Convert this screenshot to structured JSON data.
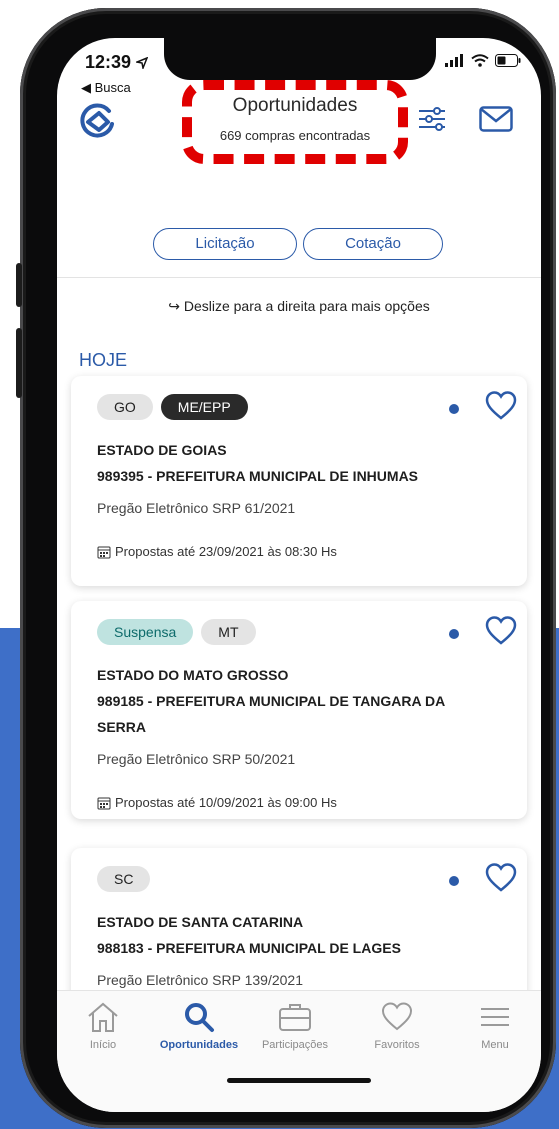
{
  "status_bar": {
    "time": "12:39",
    "back_label": "◀ Busca"
  },
  "header": {
    "title": "Oportunidades",
    "subtitle": "669 compras encontradas",
    "segments": [
      "Licitação",
      "Cotação"
    ]
  },
  "hint": "↪ Deslize para a direita para mais opções",
  "section_label": "HOJE",
  "cards": [
    {
      "tags": [
        "GO",
        "ME/EPP"
      ],
      "state": "ESTADO DE GOIAS",
      "org": "989395 - PREFEITURA MUNICIPAL DE INHUMAS",
      "org_line2": "",
      "modality": "Pregão Eletrônico SRP 61/2021",
      "deadline": "Propostas até 23/09/2021 às 08:30 Hs"
    },
    {
      "tags": [
        "Suspensa",
        "MT"
      ],
      "state": "ESTADO DO MATO GROSSO",
      "org": "989185 - PREFEITURA MUNICIPAL DE TANGARA DA",
      "org_line2": "SERRA",
      "modality": "Pregão Eletrônico SRP 50/2021",
      "deadline": "Propostas até 10/09/2021 às 09:00 Hs"
    },
    {
      "tags": [
        "SC"
      ],
      "state": "ESTADO DE SANTA CATARINA",
      "org": "988183 - PREFEITURA MUNICIPAL DE LAGES",
      "org_line2": "",
      "modality": "Pregão Eletrônico SRP 139/2021",
      "deadline": ""
    }
  ],
  "tabbar": [
    {
      "label": "Início",
      "icon": "home-icon",
      "active": false
    },
    {
      "label": "Oportunidades",
      "icon": "search-icon",
      "active": true
    },
    {
      "label": "Participações",
      "icon": "briefcase-icon",
      "active": false
    },
    {
      "label": "Favoritos",
      "icon": "heart-icon",
      "active": false
    },
    {
      "label": "Menu",
      "icon": "menu-icon",
      "active": false
    }
  ],
  "colors": {
    "accent": "#2b5aa8",
    "highlight": "#e00000",
    "background_block": "#3e6fc8"
  }
}
